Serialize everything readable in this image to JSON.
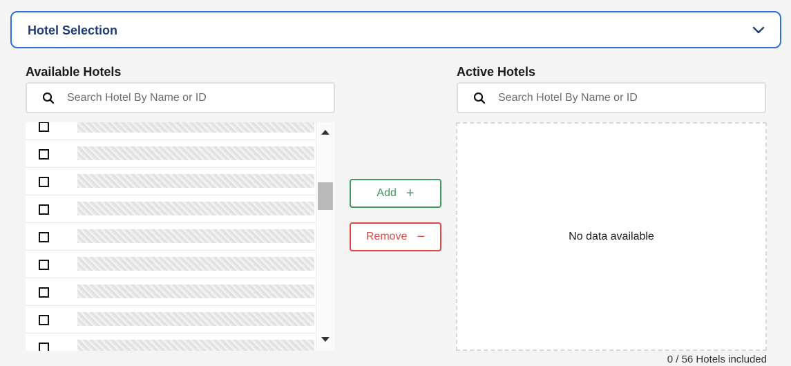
{
  "accordion": {
    "title": "Hotel Selection",
    "icon": "chevron-down-icon"
  },
  "available": {
    "title": "Available Hotels",
    "search_placeholder": "Search Hotel By Name or ID",
    "items": [
      {
        "checked": false
      },
      {
        "checked": false
      },
      {
        "checked": false
      },
      {
        "checked": false
      },
      {
        "checked": false
      },
      {
        "checked": false
      },
      {
        "checked": false
      },
      {
        "checked": false
      },
      {
        "checked": false
      }
    ]
  },
  "actions": {
    "add_label": "Add",
    "add_symbol": "+",
    "remove_label": "Remove",
    "remove_symbol": "−"
  },
  "active": {
    "title": "Active Hotels",
    "search_placeholder": "Search Hotel By Name or ID",
    "empty_text": "No data available"
  },
  "footer": {
    "summary": "0 / 56 Hotels included"
  },
  "colors": {
    "accent": "#2e6fdb",
    "add": "#3c9a5f",
    "remove": "#e04848"
  }
}
